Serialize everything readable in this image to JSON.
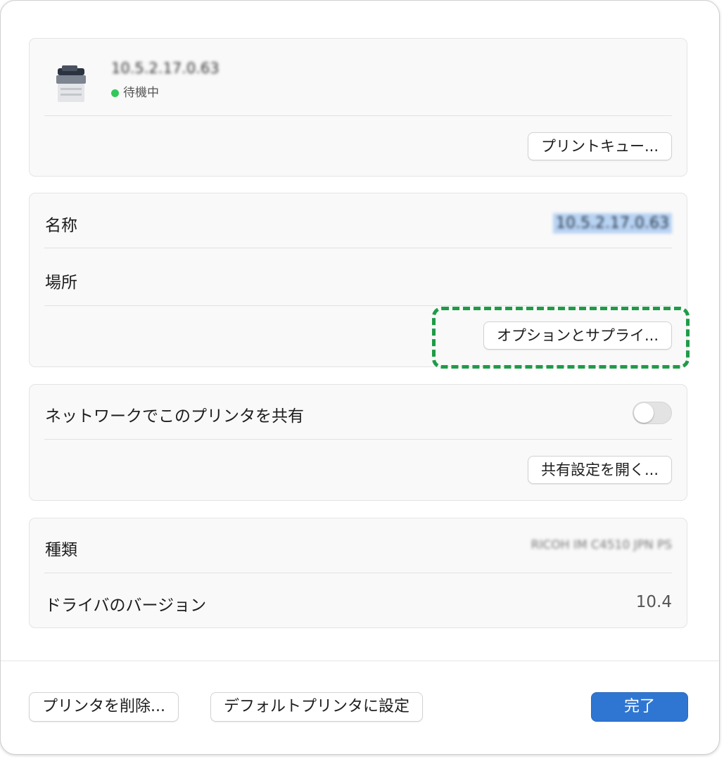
{
  "printer": {
    "name": "10.5.2.17.0.63",
    "status": "待機中",
    "status_color": "#34c759",
    "print_queue_button": "プリントキュー..."
  },
  "info": {
    "name_label": "名称",
    "name_value": "10.5.2.17.0.63",
    "location_label": "場所",
    "location_value": "",
    "options_button": "オプションとサプライ..."
  },
  "sharing": {
    "share_label": "ネットワークでこのプリンタを共有",
    "share_enabled": false,
    "open_sharing_button": "共有設定を開く..."
  },
  "details": {
    "kind_label": "種類",
    "kind_value": "RICOH IM C4510 JPN PS",
    "driver_label": "ドライバのバージョン",
    "driver_value": "10.4"
  },
  "footer": {
    "delete_button": "プリンタを削除...",
    "default_button": "デフォルトプリンタに設定",
    "done_button": "完了"
  },
  "colors": {
    "accent": "#2f76d2",
    "highlight": "#1f9b48"
  },
  "icons": {
    "printer": "printer-icon",
    "status": "status-dot-icon"
  }
}
